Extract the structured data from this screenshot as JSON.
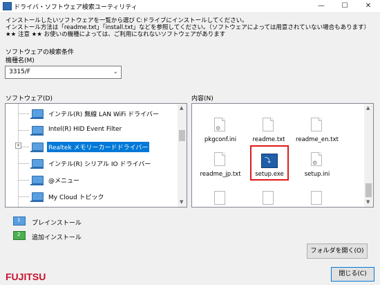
{
  "window": {
    "title": "ドライバ・ソフトウェア検索ユーティリティ",
    "minimize": "—",
    "maximize": "☐",
    "close": "✕"
  },
  "info": {
    "line1": "インストールしたいソフトウェアを一覧から選び C:ドライブにインストールしてください。",
    "line2": "インストール方法は「readme.txt」「install.txt」などを参照してください。（ソフトウェアによっては用意されていない場合もあります）",
    "line3": "★★ 注意 ★★ お使いの機種によっては、ご利用になれないソフトウェアがあります"
  },
  "search": {
    "label": "ソフトウェアの検索条件",
    "model_label": "機種名(M)",
    "model_value": "3315/F"
  },
  "software": {
    "label": "ソフトウェア(D)",
    "items": [
      {
        "label": "インテル(R) 無線 LAN WiFi ドライバー"
      },
      {
        "label": "Intel(R) HID Event Filter"
      },
      {
        "label": "Realtek メモリーカードドライバー"
      },
      {
        "label": "インテル(R) シリアル IO ドライバー"
      },
      {
        "label": "@メニュー"
      },
      {
        "label": "My Cloud トピック"
      }
    ],
    "expander": "+"
  },
  "contents": {
    "label": "内容(N)",
    "files": [
      {
        "name": "pkgconf.ini"
      },
      {
        "name": "readme.txt"
      },
      {
        "name": "readme_en.txt"
      },
      {
        "name": "readme_jp.txt"
      },
      {
        "name": "setup.exe"
      },
      {
        "name": "setup.ini"
      }
    ]
  },
  "legend": {
    "preinstall": "プレインストール",
    "additional": "追加インストール",
    "num1": "1",
    "num2": "2"
  },
  "buttons": {
    "open_folder": "フォルダを開く(O)",
    "close": "閉じる(C)"
  },
  "brand": {
    "logo": "FUJITSU"
  },
  "colors": {
    "selection": "#0078d7",
    "highlight_box": "#e01818",
    "logo": "#c8102e"
  }
}
